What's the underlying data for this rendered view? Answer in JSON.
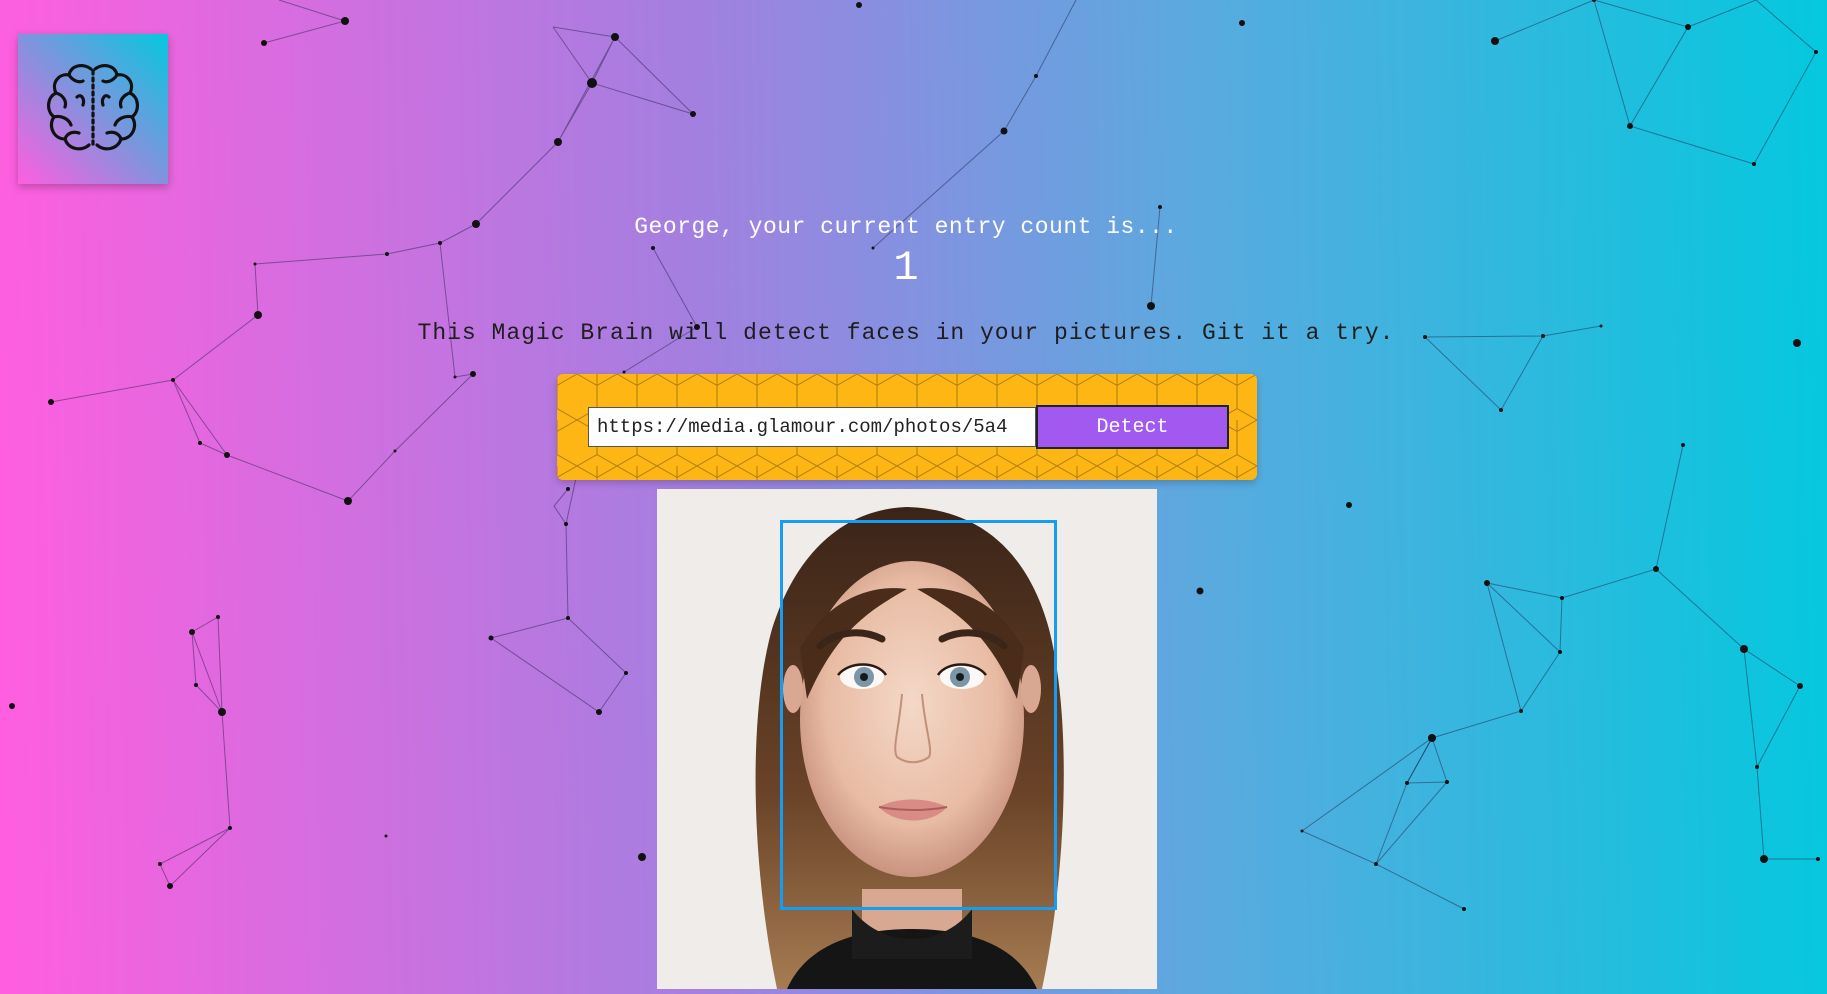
{
  "app": {
    "logo_icon": "brain-icon",
    "background_gradient": [
      "#ff5edf",
      "#a47fe0",
      "#59aadf",
      "#04c8de"
    ]
  },
  "rank": {
    "message": "George, your current entry count is...",
    "count": "1"
  },
  "intro": {
    "text": "This Magic Brain will detect faces in your pictures. Git it a try."
  },
  "image_form": {
    "url_value": "https://media.glamour.com/photos/5a4",
    "detect_label": "Detect",
    "button_color": "#a259f0",
    "panel_color": "#fdb614"
  },
  "result": {
    "bounding_box_color": "#149df2"
  }
}
